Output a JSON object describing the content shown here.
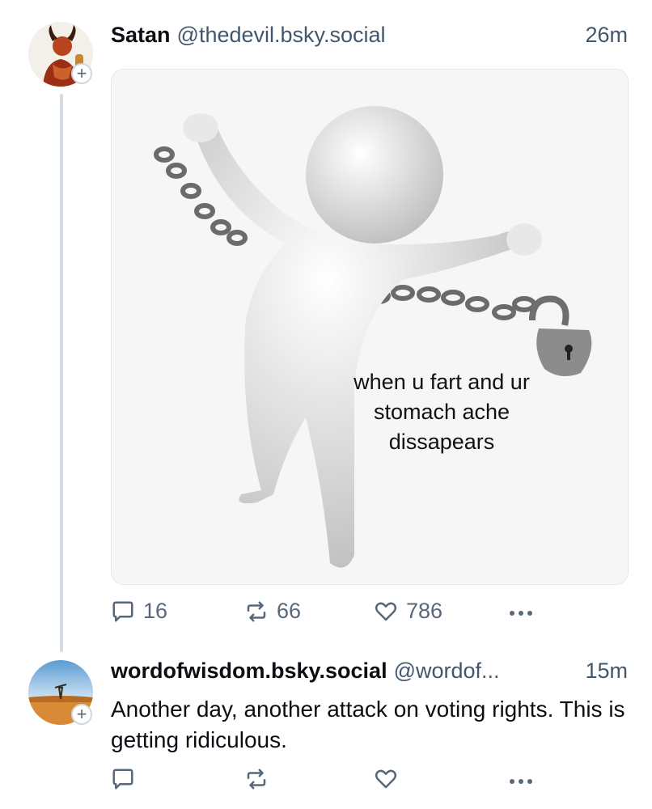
{
  "post1": {
    "display_name": "Satan",
    "handle": "@thedevil.bsky.social",
    "time": "26m",
    "image_caption": "when u fart and ur stomach ache dissapears",
    "actions": {
      "replies": "16",
      "reposts": "66",
      "likes": "786"
    }
  },
  "post2": {
    "display_name": "wordofwisdom.bsky.social",
    "handle": "@wordof...",
    "time": "15m",
    "text": "Another day, another attack on voting rights. This is getting ridiculous."
  },
  "colors": {
    "accent_gray": "#58677a",
    "thread_line": "#d4dbe2"
  },
  "icons": [
    "reply-icon",
    "repost-icon",
    "like-icon",
    "more-icon",
    "plus-icon"
  ]
}
